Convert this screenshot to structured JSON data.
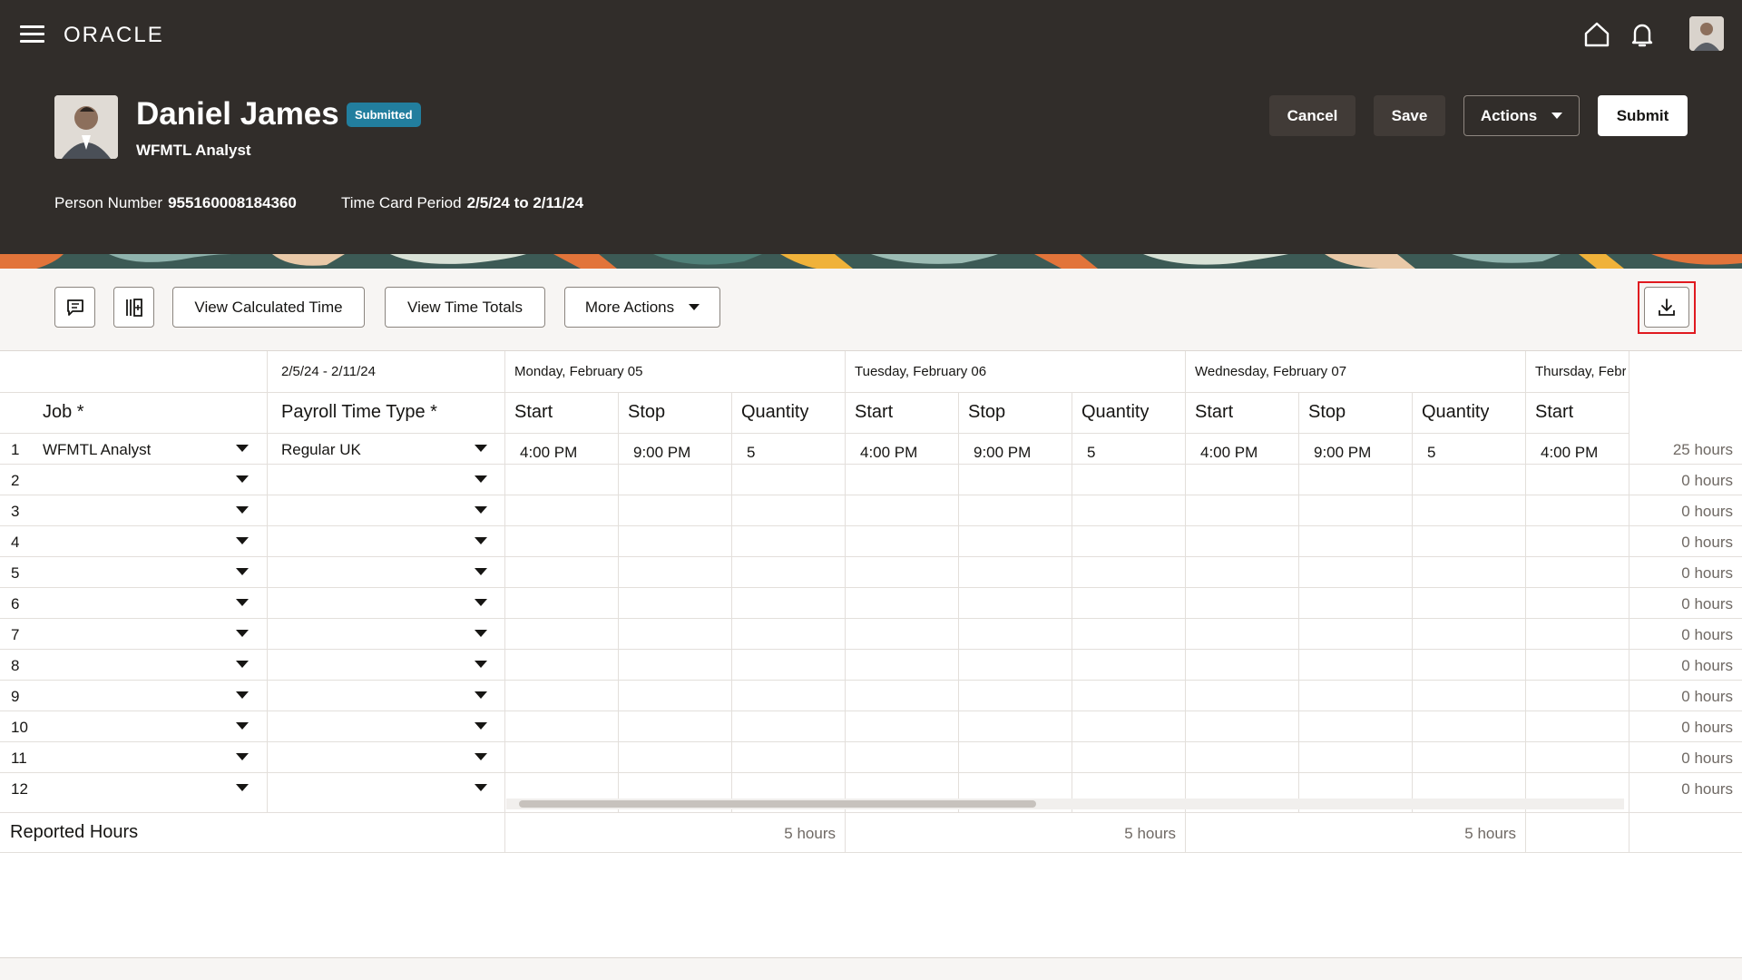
{
  "header": {
    "logo": "ORACLE",
    "name": "Daniel James",
    "status_badge": "Submitted",
    "job_title": "WFMTL Analyst",
    "person_number_label": "Person Number",
    "person_number": "955160008184360",
    "period_label": "Time Card Period",
    "period": "2/5/24 to 2/11/24",
    "buttons": {
      "cancel": "Cancel",
      "save": "Save",
      "actions": "Actions",
      "submit": "Submit"
    },
    "icons": [
      "menu-icon",
      "home-icon",
      "notifications-icon",
      "user-avatar"
    ]
  },
  "toolbar": {
    "comments_icon": "comments-icon",
    "columns_icon": "manage-columns-icon",
    "view_calculated": "View Calculated Time",
    "view_totals": "View Time Totals",
    "more_actions": "More Actions",
    "download_icon": "download-icon"
  },
  "grid": {
    "period_range": "2/5/24 - 2/11/24",
    "days": [
      "Monday, February 05",
      "Tuesday, February 06",
      "Wednesday, February 07",
      "Thursday, Febr"
    ],
    "headers": {
      "job": "Job *",
      "payroll": "Payroll Time Type *",
      "start": "Start",
      "stop": "Stop",
      "quantity": "Quantity"
    },
    "rows": [
      {
        "num": "1",
        "job": "WFMTL Analyst",
        "payroll": "Regular UK",
        "mon": [
          "4:00 PM",
          "9:00 PM",
          "5"
        ],
        "tue": [
          "4:00 PM",
          "9:00 PM",
          "5"
        ],
        "wed": [
          "4:00 PM",
          "9:00 PM",
          "5"
        ],
        "thu": [
          "4:00 PM"
        ],
        "total": "25 hours"
      },
      {
        "num": "2",
        "total": "0 hours"
      },
      {
        "num": "3",
        "total": "0 hours"
      },
      {
        "num": "4",
        "total": "0 hours"
      },
      {
        "num": "5",
        "total": "0 hours"
      },
      {
        "num": "6",
        "total": "0 hours"
      },
      {
        "num": "7",
        "total": "0 hours"
      },
      {
        "num": "8",
        "total": "0 hours"
      },
      {
        "num": "9",
        "total": "0 hours"
      },
      {
        "num": "10",
        "total": "0 hours"
      },
      {
        "num": "11",
        "total": "0 hours"
      },
      {
        "num": "12",
        "total": "0 hours"
      }
    ],
    "reported_label": "Reported Hours",
    "reported": [
      "5 hours",
      "5 hours",
      "5 hours"
    ]
  }
}
